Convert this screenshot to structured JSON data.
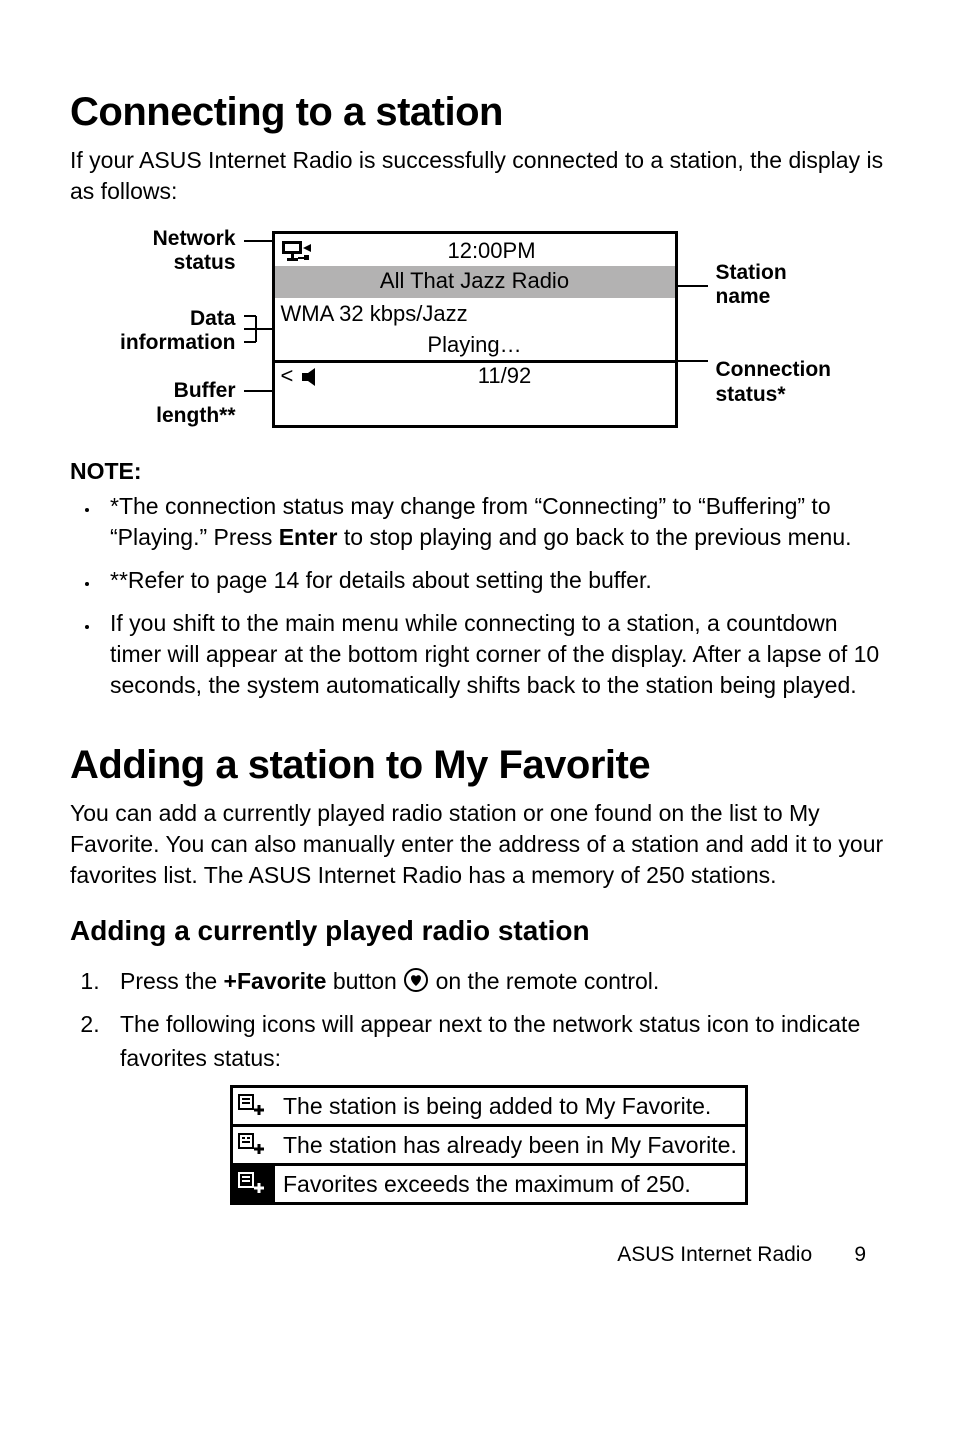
{
  "h1_connect": "Connecting to a station",
  "intro_connect": "If your ASUS Internet Radio is successfully connected to a station, the display is as follows:",
  "diagram": {
    "left": {
      "network": "Network status",
      "data": "Data information",
      "buffer": "Buffer length**"
    },
    "screen": {
      "time": "12:00PM",
      "station": "All That Jazz Radio",
      "data_line": "WMA 32 kbps/Jazz",
      "status_line": "Playing…",
      "lt_symbol": "<",
      "buffer_value": "11/92"
    },
    "right": {
      "station": "Station name",
      "connection": "Connection status*"
    }
  },
  "note_head": "NOTE:",
  "notes": [
    "*The connection status may change from “Connecting” to “Buffering” to “Playing.” Press Enter to stop playing and go back to the previous menu.",
    "**Refer to page 14 for details about setting the buffer.",
    "If you shift to the main menu while connecting to a station, a countdown timer will appear at the bottom right corner of the display. After a lapse of 10 seconds, the system automatically shifts back to the station being played."
  ],
  "note0_pre": "*The connection status may change from “Connecting” to “Buffering” to “Playing.” Press ",
  "note0_bold": "Enter",
  "note0_post": " to stop playing and go back to the previous menu.",
  "h1_favorite": "Adding a station to My Favorite",
  "fav_para": "You can add a currently played radio station or one found on the list to My Favorite. You can also manually enter the address of a station and add it to your favorites list. The ASUS Internet Radio has a memory of 250 stations.",
  "h2_current": "Adding a currently played radio station",
  "step1_pre": "Press the ",
  "step1_bold": "+Favorite",
  "step1_mid": " button ",
  "step1_post": " on the remote control.",
  "step2": "The following icons will appear next to the network status icon to indicate favorites status:",
  "icon_rows": {
    "adding": "The station is being added to My Favorite.",
    "already": "The station has already been in My Favorite.",
    "full": "Favorites exceeds the maximum of 250."
  },
  "footer_text": "ASUS Internet Radio",
  "footer_page": "9"
}
